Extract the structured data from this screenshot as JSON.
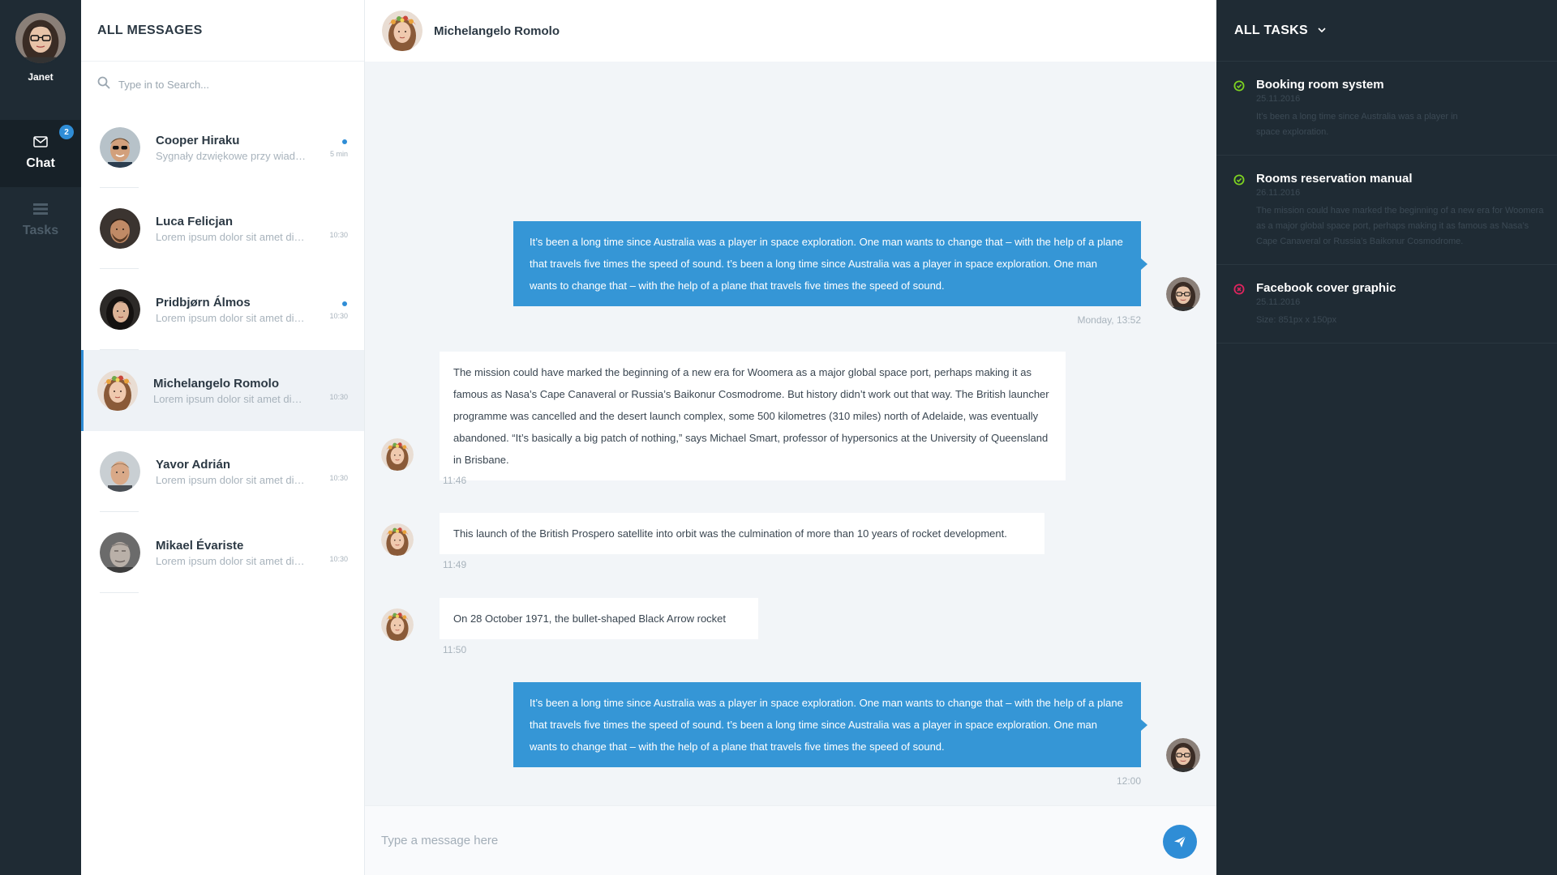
{
  "rail": {
    "user_name": "Janet",
    "nav": [
      {
        "label": "Chat",
        "icon": "envelope-icon",
        "badge": "2",
        "active": true
      },
      {
        "label": "Tasks",
        "icon": "tasks-icon",
        "active": false
      }
    ]
  },
  "messages_panel": {
    "title": "ALL MESSAGES",
    "search_placeholder": "Type in to Search...",
    "conversations": [
      {
        "name": "Cooper Hiraku",
        "preview": "Sygnały dzwiękowe przy wiadomościach",
        "time": "5 min",
        "unread": true
      },
      {
        "name": "Luca Felicjan",
        "preview": "Lorem ipsum dolor sit amet dicta sunt",
        "time": "10:30",
        "unread": false
      },
      {
        "name": "Pridbjørn Álmos",
        "preview": "Lorem ipsum dolor sit amet dicta sunt",
        "time": "10:30",
        "unread": true
      },
      {
        "name": "Michelangelo Romolo",
        "preview": "Lorem ipsum dolor sit amet dicta sunt",
        "time": "10:30",
        "unread": false,
        "active": true
      },
      {
        "name": "Yavor Adrián",
        "preview": "Lorem ipsum dolor sit amet dicta sunt",
        "time": "10:30",
        "unread": false
      },
      {
        "name": "Mikael Évariste",
        "preview": "Lorem ipsum dolor sit amet dicta sunt",
        "time": "10:30",
        "unread": false
      }
    ]
  },
  "chat": {
    "contact_name": "Michelangelo Romolo",
    "messages": [
      {
        "direction": "out",
        "text": "It’s been a long time since Australia was a player in space exploration. One man wants to change that – with the help of a plane that travels five times the speed of sound. t’s been a long time since Australia was a player in space exploration. One man wants to change that – with the help of a plane that travels five times the speed of sound.",
        "time": "Monday, 13:52"
      },
      {
        "direction": "in",
        "text": "The mission could have marked the beginning of a new era for Woomera as a major global space port, perhaps making it as famous as Nasa’s Cape Canaveral or Russia’s Baikonur Cosmodrome. But history didn’t work out that way. The British launcher programme was cancelled and the desert launch complex, some 500 kilometres (310 miles) north of Adelaide, was eventually abandoned. “It’s basically a big patch of nothing,” says Michael Smart, professor of hypersonics at the University of Queensland in Brisbane.",
        "time": "11:46"
      },
      {
        "direction": "in",
        "text": "This launch of the British Prospero satellite into orbit was the culmination of more than 10 years of rocket development.",
        "time": "11:49"
      },
      {
        "direction": "in",
        "text": "On 28 October 1971, the bullet-shaped Black Arrow rocket",
        "time": "11:50"
      },
      {
        "direction": "out",
        "text": "It’s been a long time since Australia was a player in space exploration. One man wants to change that – with the help of a plane that travels five times the speed of sound. t’s been a long time since Australia was a player in space exploration. One man wants to change that – with the help of a plane that travels five times the speed of sound.",
        "time": "12:00"
      }
    ],
    "composer_placeholder": "Type a message here"
  },
  "tasks_panel": {
    "title": "ALL TASKS",
    "tasks": [
      {
        "title": "Booking room system",
        "date": "25.11.2016",
        "description": "It’s been a long time since Australia was a player in space exploration.",
        "status": "done",
        "status_color": "#7ed321"
      },
      {
        "title": "Rooms reservation manual",
        "date": "26.11.2016",
        "description": "The mission could have marked the beginning of a new era for Woomera as a major global space port, perhaps making it as famous as Nasa’s Cape Canaveral or Russia’s Baikonur Cosmodrome.",
        "status": "done",
        "status_color": "#7ed321"
      },
      {
        "title": "Facebook cover graphic",
        "date": "25.11.2016",
        "description": "Size: 851px x 150px",
        "status": "cancelled",
        "status_color": "#e0245e"
      }
    ]
  },
  "colors": {
    "accent": "#2f8dd6",
    "dark": "#1f2b34",
    "done": "#7ed321",
    "cancelled": "#e0245e"
  }
}
